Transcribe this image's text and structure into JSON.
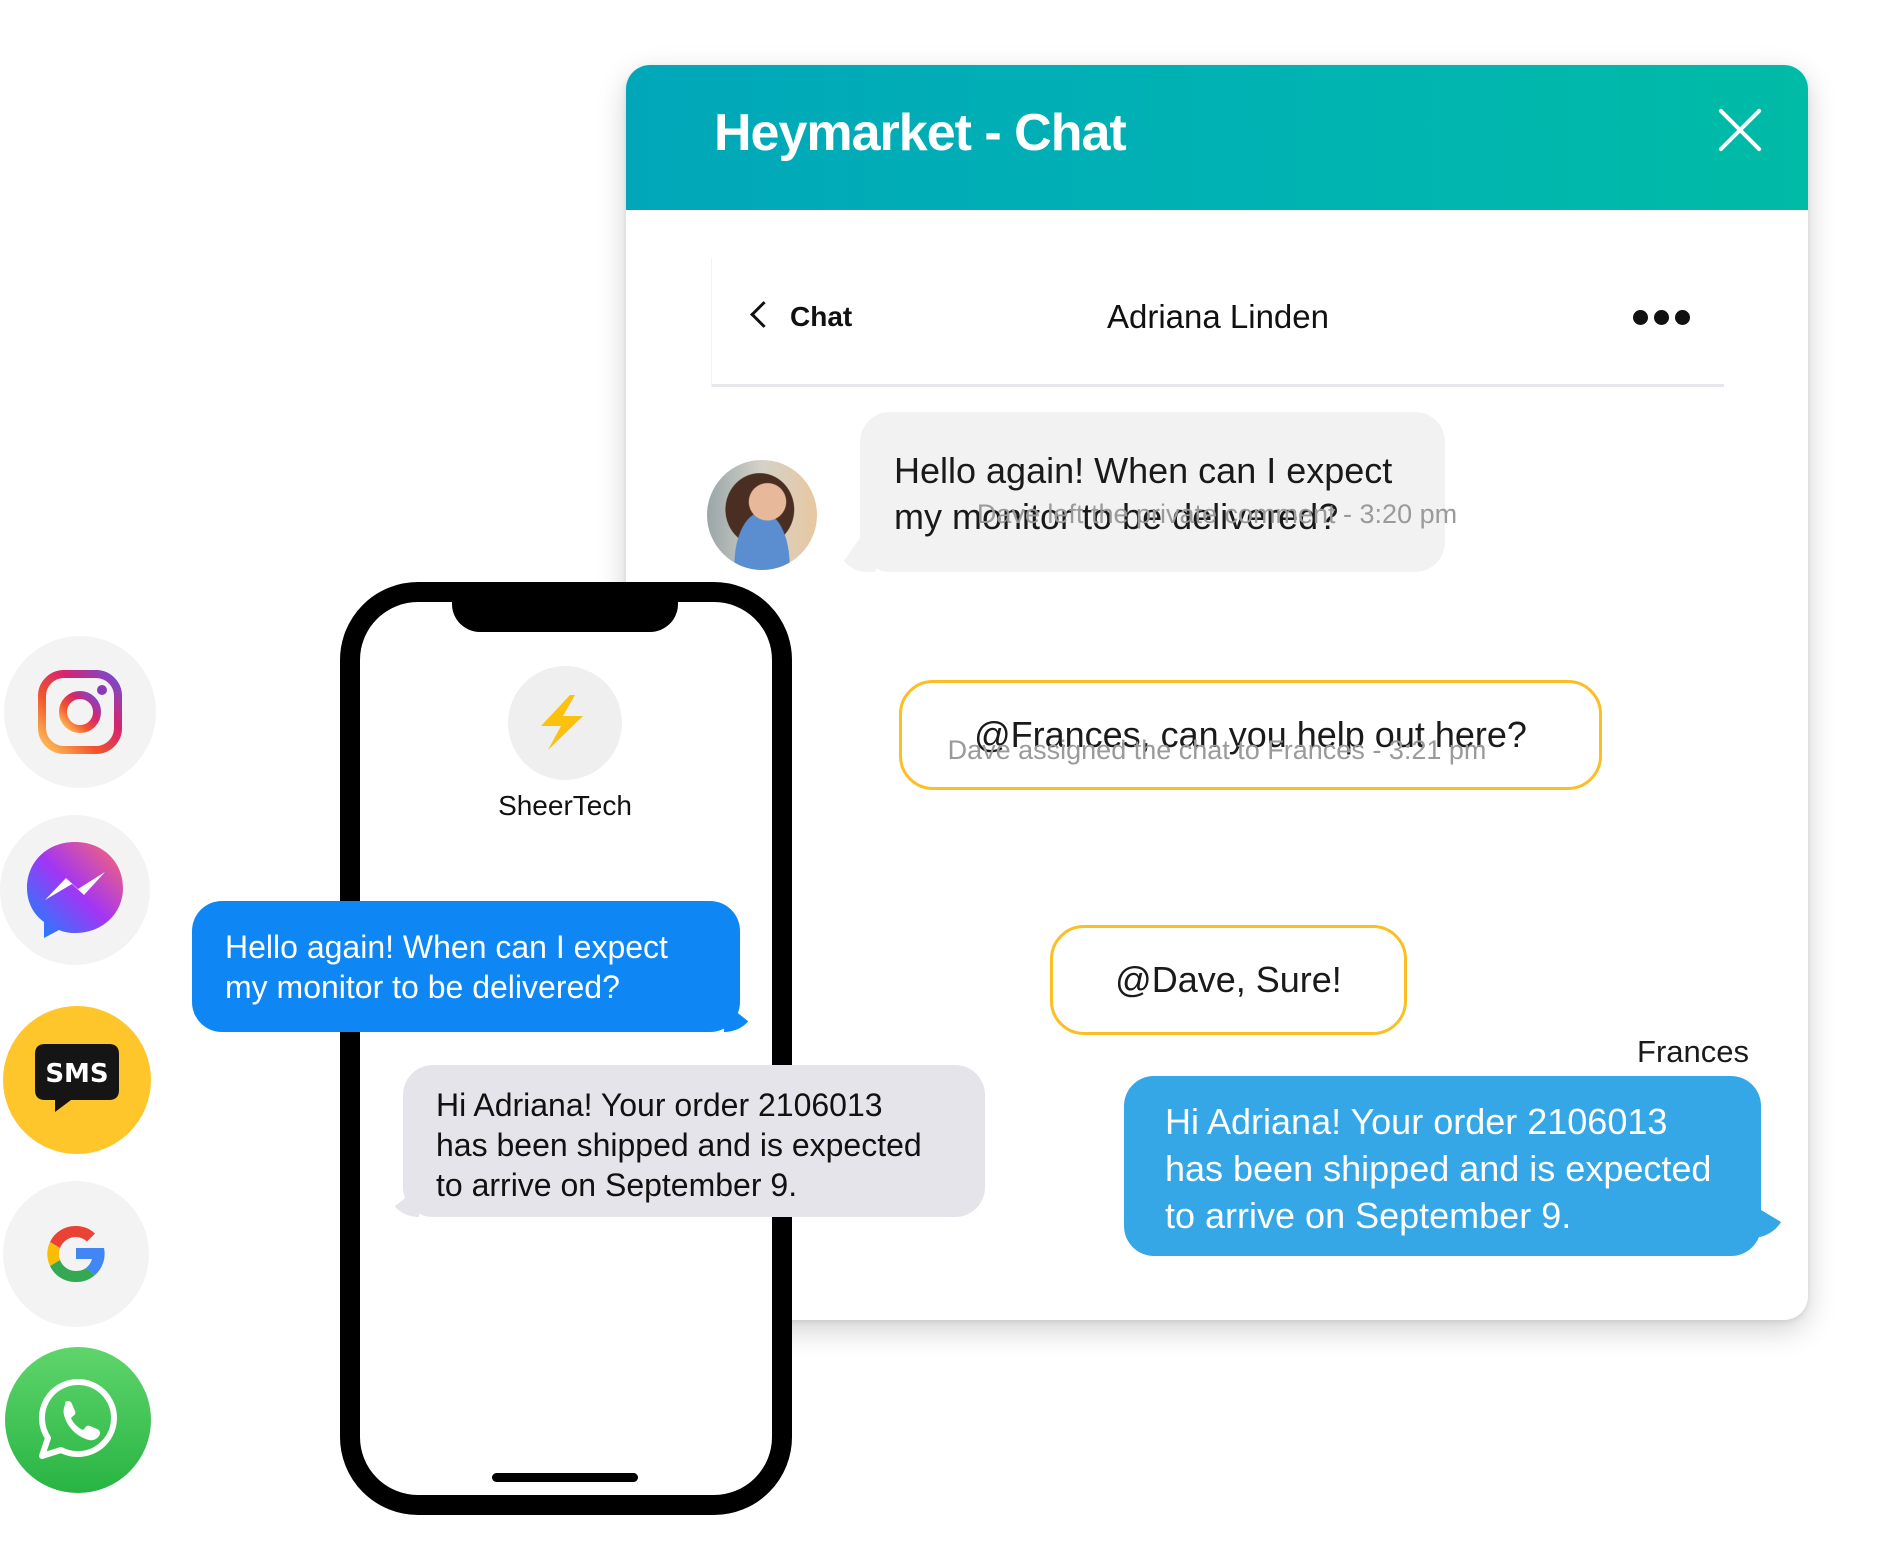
{
  "chat_window": {
    "title": "Heymarket - Chat",
    "close_label": "close",
    "header_colors": [
      "#01a7b9",
      "#00bba6"
    ],
    "subheader": {
      "back_label": "Chat",
      "contact_name": "Adriana Linden",
      "more_icon": "more-horizontal-icon"
    },
    "messages": [
      {
        "type": "incoming",
        "text_lines": [
          "Hello again! When can I expect",
          "my monitor to be delivered?"
        ]
      },
      {
        "type": "system",
        "text": "Dave left the private comment - 3:20 pm"
      },
      {
        "type": "private_note",
        "text": "@Frances, can you help out here?"
      },
      {
        "type": "system",
        "text": "Dave assigned the chat to Frances - 3:21 pm"
      },
      {
        "type": "private_note",
        "text": "@Dave, Sure!"
      },
      {
        "type": "outgoing",
        "sender": "Frances",
        "text_lines": [
          "Hi Adriana! Your order 2106013",
          "has been shipped and is expected",
          "to arrive on September 9."
        ]
      }
    ],
    "colors": {
      "note_border": "#fbbf24",
      "outgoing_bubble": "#35a7e6",
      "incoming_bubble": "#f2f2f2"
    }
  },
  "phone": {
    "brand_name": "SheerTech",
    "brand_icon": "lightning-bolt-icon",
    "messages": [
      {
        "type": "outgoing",
        "text_lines": [
          "Hello again! When can I expect",
          "my monitor to be delivered?"
        ]
      },
      {
        "type": "incoming",
        "text_lines": [
          "Hi Adriana! Your order 2106013",
          "has been shipped and is expected",
          "to arrive on September 9."
        ]
      }
    ],
    "colors": {
      "blue_bubble": "#0e87f5",
      "gray_bubble": "#e4e4ea"
    }
  },
  "channels": [
    {
      "name": "Instagram",
      "icon": "instagram-icon"
    },
    {
      "name": "Messenger",
      "icon": "messenger-icon"
    },
    {
      "name": "SMS",
      "icon": "sms-icon",
      "label": "SMS"
    },
    {
      "name": "Google",
      "icon": "google-icon"
    },
    {
      "name": "WhatsApp",
      "icon": "whatsapp-icon"
    }
  ]
}
